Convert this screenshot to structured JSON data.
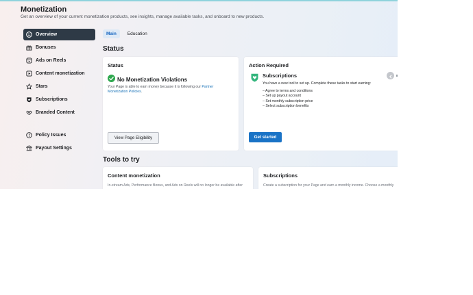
{
  "header": {
    "title": "Monetization",
    "subtitle": "Get an overview of your current monetization products, see insights, manage available tasks, and onboard to new products."
  },
  "sidebar": {
    "items": [
      {
        "label": "Overview",
        "icon": "overview-icon"
      },
      {
        "label": "Bonuses",
        "icon": "gift-icon"
      },
      {
        "label": "Ads on Reels",
        "icon": "reels-icon"
      },
      {
        "label": "Content monetization",
        "icon": "play-icon"
      },
      {
        "label": "Stars",
        "icon": "stars-icon"
      },
      {
        "label": "Subscriptions",
        "icon": "subscription-icon"
      },
      {
        "label": "Branded Content",
        "icon": "handshake-icon"
      }
    ],
    "secondary": [
      {
        "label": "Policy Issues",
        "icon": "alert-icon"
      },
      {
        "label": "Payout Settings",
        "icon": "bank-icon"
      }
    ]
  },
  "tabs": [
    {
      "label": "Main",
      "active": true
    },
    {
      "label": "Education",
      "active": false
    }
  ],
  "status_section": {
    "title": "Status",
    "card": {
      "title": "Status",
      "status_text": "No Monetization Violations",
      "description_before": "Your Page is able to earn money because it is following our",
      "description_link": "Partner Monetization Policies",
      "description_after": ".",
      "button_label": "View Page Eligibility"
    }
  },
  "action_required": {
    "title": "Action Required",
    "task_title": "Subscriptions",
    "task_description": "You have a new tool to set up. Complete these tasks to start earning:",
    "tasks": [
      "– Agree to terms and conditions",
      "– Set up payout account",
      "– Set monthly subscription price",
      "– Select subscription benefits"
    ],
    "button_label": "Get started"
  },
  "tools_section": {
    "title": "Tools to try",
    "cards": [
      {
        "title": "Content monetization",
        "description": "In-stream Ads, Performance Bonus, and Ads on Reels will no longer be available after"
      },
      {
        "title": "Subscriptions",
        "description": "Create a subscription for your Page and earn a monthly income. Choose a monthly"
      }
    ]
  },
  "colors": {
    "accent": "#1a73c6",
    "active_nav": "#2e3a46",
    "success": "#2fa84f",
    "task_icon": "#33b57d"
  }
}
